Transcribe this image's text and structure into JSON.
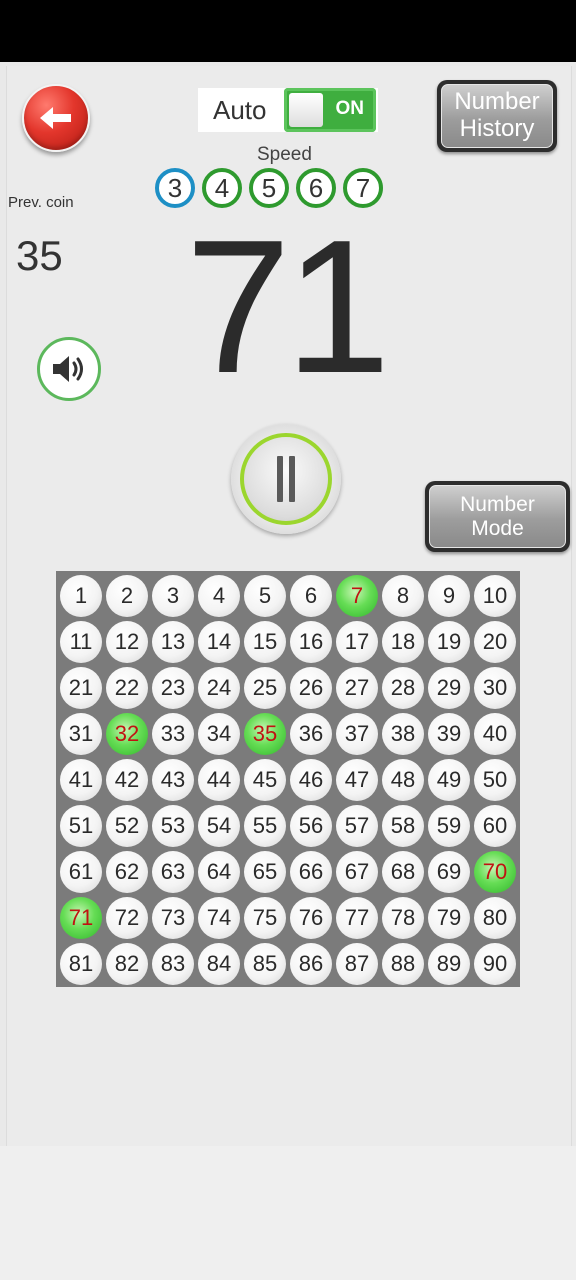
{
  "header": {
    "back_icon": "arrow-left-icon",
    "auto_label": "Auto",
    "auto_toggle": "ON",
    "history_button": [
      "Number",
      "History"
    ]
  },
  "speed": {
    "label": "Speed",
    "options": [
      "3",
      "4",
      "5",
      "6",
      "7"
    ],
    "selected": "3"
  },
  "previous": {
    "label": "Prev. coin",
    "value": "35"
  },
  "current_number": "71",
  "controls": {
    "sound_icon": "speaker-icon",
    "pause_icon": "pause-icon",
    "mode_button": [
      "Number",
      "Mode"
    ]
  },
  "board": {
    "numbers": [
      "1",
      "2",
      "3",
      "4",
      "5",
      "6",
      "7",
      "8",
      "9",
      "10",
      "11",
      "12",
      "13",
      "14",
      "15",
      "16",
      "17",
      "18",
      "19",
      "20",
      "21",
      "22",
      "23",
      "24",
      "25",
      "26",
      "27",
      "28",
      "29",
      "30",
      "31",
      "32",
      "33",
      "34",
      "35",
      "36",
      "37",
      "38",
      "39",
      "40",
      "41",
      "42",
      "43",
      "44",
      "45",
      "46",
      "47",
      "48",
      "49",
      "50",
      "51",
      "52",
      "53",
      "54",
      "55",
      "56",
      "57",
      "58",
      "59",
      "60",
      "61",
      "62",
      "63",
      "64",
      "65",
      "66",
      "67",
      "68",
      "69",
      "70",
      "71",
      "72",
      "73",
      "74",
      "75",
      "76",
      "77",
      "78",
      "79",
      "80",
      "81",
      "82",
      "83",
      "84",
      "85",
      "86",
      "87",
      "88",
      "89",
      "90"
    ],
    "drawn": [
      "7",
      "32",
      "35",
      "70",
      "71"
    ]
  },
  "colors": {
    "accent_green": "#3fae3f",
    "drawn_text": "#c01212",
    "back_red": "#e3362c"
  }
}
